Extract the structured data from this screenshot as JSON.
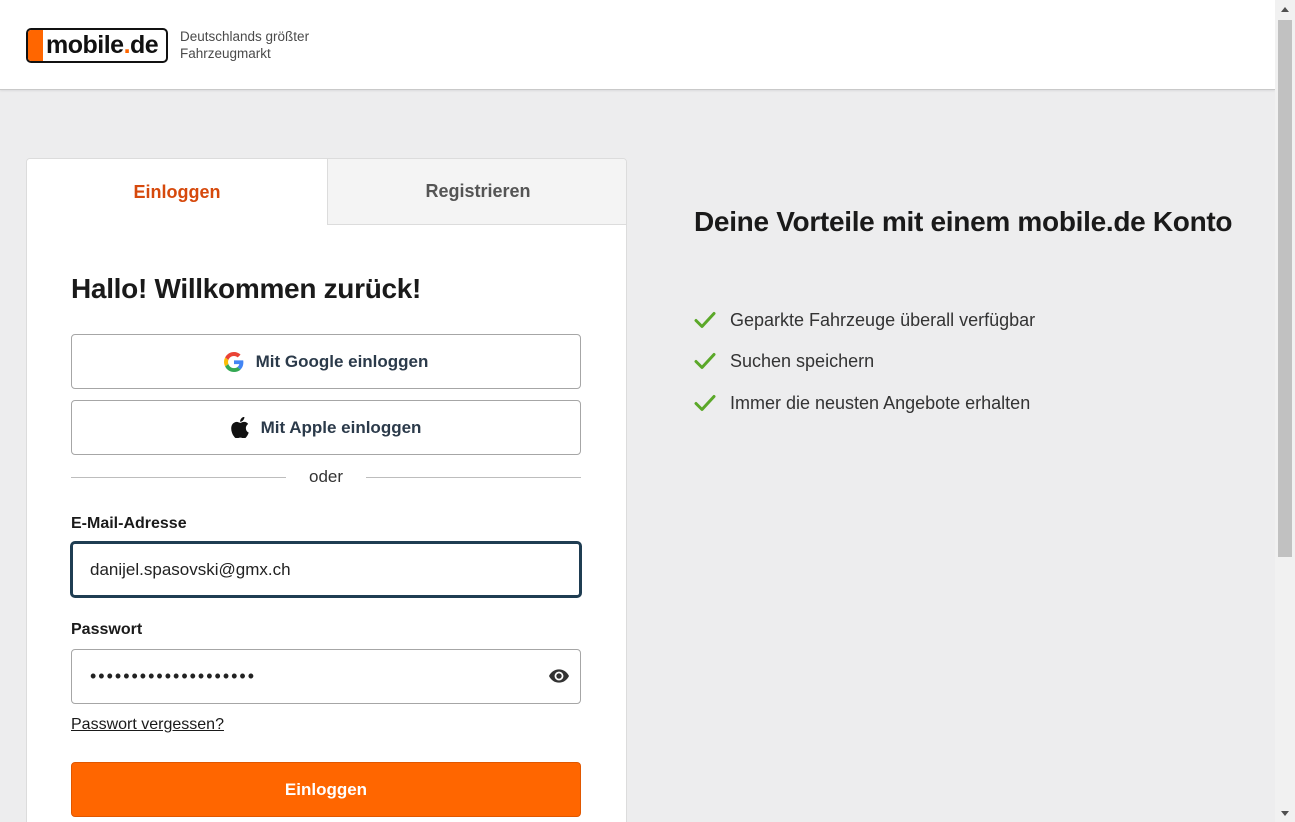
{
  "header": {
    "logo_text_main": "mobile",
    "logo_text_dot": ".",
    "logo_text_tld": "de",
    "tagline_line1": "Deutschlands größter",
    "tagline_line2": "Fahrzeugmarkt"
  },
  "tabs": {
    "login_label": "Einloggen",
    "register_label": "Registrieren",
    "active": "login"
  },
  "login": {
    "title": "Hallo! Willkommen zurück!",
    "google_label": "Mit Google einloggen",
    "apple_label": "Mit Apple einloggen",
    "divider_text": "oder",
    "email_label": "E-Mail-Adresse",
    "email_value": "danijel.spasovski@gmx.ch",
    "password_label": "Passwort",
    "password_value": "••••••••••••••••••••",
    "forgot_label": "Passwort vergessen?",
    "submit_label": "Einloggen"
  },
  "benefits": {
    "title": "Deine Vorteile mit einem mobile.de Konto",
    "items": [
      "Geparkte Fahrzeuge überall verfügbar",
      "Suchen speichern",
      "Immer die neusten Angebote erhalten"
    ]
  },
  "colors": {
    "accent": "#ff6600",
    "active_tab": "#d6490c",
    "check": "#5ba829",
    "focus_border": "#1f3d52",
    "page_bg": "#ededee"
  },
  "icons": {
    "google": "google-icon",
    "apple": "apple-icon",
    "eye": "eye-icon",
    "check": "check-icon"
  }
}
